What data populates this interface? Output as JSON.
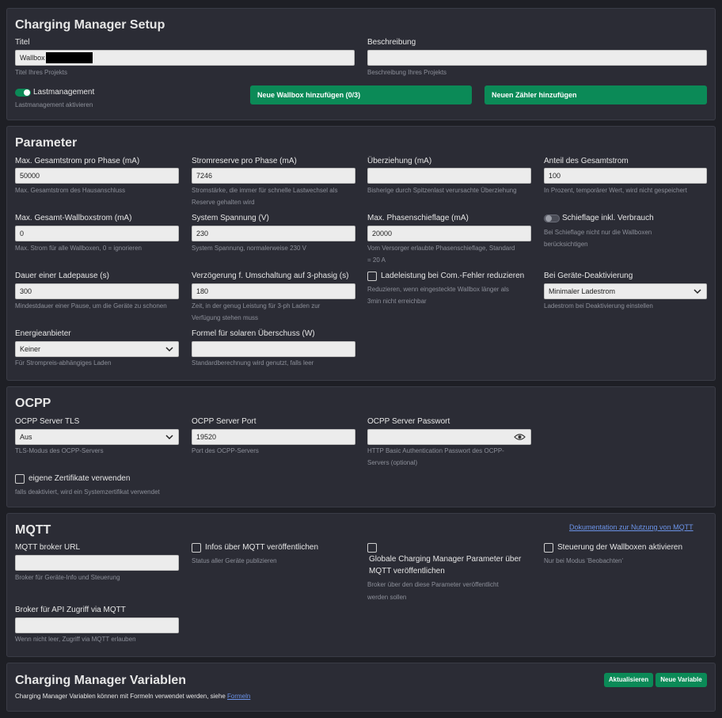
{
  "setup": {
    "title": "Charging Manager Setup",
    "titel_label": "Titel",
    "titel_value": "Wallbox",
    "titel_hint": "Titel Ihres Projekts",
    "beschreibung_label": "Beschreibung",
    "beschreibung_value": "",
    "beschreibung_hint": "Beschreibung Ihres Projekts",
    "lastmanagement_label": "Lastmanagement",
    "lastmanagement_on": true,
    "lastmanagement_hint": "Lastmanagement aktivieren",
    "add_wallbox_label": "Neue Wallbox hinzufügen (0/3)",
    "add_meter_label": "Neuen Zähler hinzufügen"
  },
  "parameter": {
    "title": "Parameter",
    "max_total_label": "Max. Gesamtstrom pro Phase (mA)",
    "max_total_value": "50000",
    "max_total_hint": "Max. Gesamtstrom des Hausanschluss",
    "reserve_label": "Stromreserve pro Phase (mA)",
    "reserve_value": "7246",
    "reserve_hint1": "Stromstärke, die immer für schnelle Lastwechsel als",
    "reserve_hint2": "Reserve gehalten wird",
    "overdraw_label": "Überziehung (mA)",
    "overdraw_value": "",
    "overdraw_hint": "Bisherige durch Spitzenlast verursachte Überziehung",
    "share_label": "Anteil des Gesamtstrom",
    "share_value": "100",
    "share_hint": "In Prozent, temporärer Wert, wird nicht gespeichert",
    "max_wallbox_label": "Max. Gesamt-Wallboxstrom (mA)",
    "max_wallbox_value": "0",
    "max_wallbox_hint": "Max. Strom für alle Wallboxen, 0 = ignorieren",
    "voltage_label": "System Spannung (V)",
    "voltage_value": "230",
    "voltage_hint": "System Spannung, normalerweise 230 V",
    "imbalance_label": "Max. Phasenschieflage (mA)",
    "imbalance_value": "20000",
    "imbalance_hint1": "Vom Versorger erlaubte Phasenschieflage, Standard",
    "imbalance_hint2": "= 20 A",
    "imbalance_incl_label": "Schieflage inkl. Verbrauch",
    "imbalance_incl_on": false,
    "imbalance_incl_hint1": "Bei Schieflage nicht nur die Wallboxen",
    "imbalance_incl_hint2": "berücksichtigen",
    "pause_label": "Dauer einer Ladepause (s)",
    "pause_value": "300",
    "pause_hint": "Mindestdauer einer Pause, um die Geräte zu schonen",
    "delay_label": "Verzögerung f. Umschaltung auf 3-phasig (s)",
    "delay_value": "180",
    "delay_hint1": "Zeit, in der genug Leistung für 3-ph Laden zur",
    "delay_hint2": "Verfügung stehen muss",
    "reduce_label": "Ladeleistung bei Com.-Fehler reduzieren",
    "reduce_checked": false,
    "reduce_hint1": "Reduzieren, wenn eingesteckte Wallbox länger als",
    "reduce_hint2": "3min nicht erreichbar",
    "deactivation_label": "Bei Geräte-Deaktivierung",
    "deactivation_value": "Minimaler Ladestrom",
    "deactivation_hint": "Ladestrom bei Deaktivierung einstellen",
    "provider_label": "Energieanbieter",
    "provider_value": "Keiner",
    "provider_hint": "Für Strompreis-abhängiges Laden",
    "formula_label": "Formel für solaren Überschuss (W)",
    "formula_value": "",
    "formula_hint": "Standardberechnung wird genutzt, falls leer"
  },
  "ocpp": {
    "title": "OCPP",
    "tls_label": "OCPP Server TLS",
    "tls_value": "Aus",
    "tls_hint": "TLS-Modus des OCPP-Servers",
    "port_label": "OCPP Server Port",
    "port_value": "19520",
    "port_hint": "Port des OCPP-Servers",
    "password_label": "OCPP Server Passwort",
    "password_value": "",
    "password_hint1": "HTTP Basic Authentication Passwort des OCPP-",
    "password_hint2": "Servers (optional)",
    "cert_label": "eigene Zertifikate verwenden",
    "cert_checked": false,
    "cert_hint": "falls deaktiviert, wird ein Systemzertifikat verwendet"
  },
  "mqtt": {
    "title": "MQTT",
    "doc_link": "Dokumentation zur Nutzung von MQTT",
    "broker_label": "MQTT broker URL",
    "broker_value": "",
    "broker_hint": "Broker für Geräte-Info und Steuerung",
    "publish_label": "Infos über MQTT veröffentlichen",
    "publish_hint": "Status aller Geräte publizieren",
    "global_label1": "Globale Charging Manager Parameter über",
    "global_label2": "MQTT veröffentlichen",
    "global_hint1": "Broker über den diese Parameter veröffentlicht",
    "global_hint2": "werden sollen",
    "control_label": "Steuerung der Wallboxen aktivieren",
    "control_hint": "Nur bei Modus 'Beobachten'",
    "api_label": "Broker für API Zugriff via MQTT",
    "api_value": "",
    "api_hint": "Wenn nicht leer, Zugriff via MQTT erlauben"
  },
  "variables": {
    "title": "Charging Manager Variablen",
    "refresh_label": "Aktualisieren",
    "new_label": "Neue Variable",
    "desc": "Charging Manager Variablen können mit Formeln verwendet werden, siehe",
    "link": "Formeln"
  },
  "icons": {
    "toggle": "toggle-switch",
    "chevron": "chevron-down-icon",
    "eye": "eye-icon",
    "checkbox": "checkbox-icon"
  },
  "colors": {
    "background": "#1e1f25",
    "card": "#2b2c35",
    "accent": "#0b8a57",
    "link": "#6b93e8"
  }
}
